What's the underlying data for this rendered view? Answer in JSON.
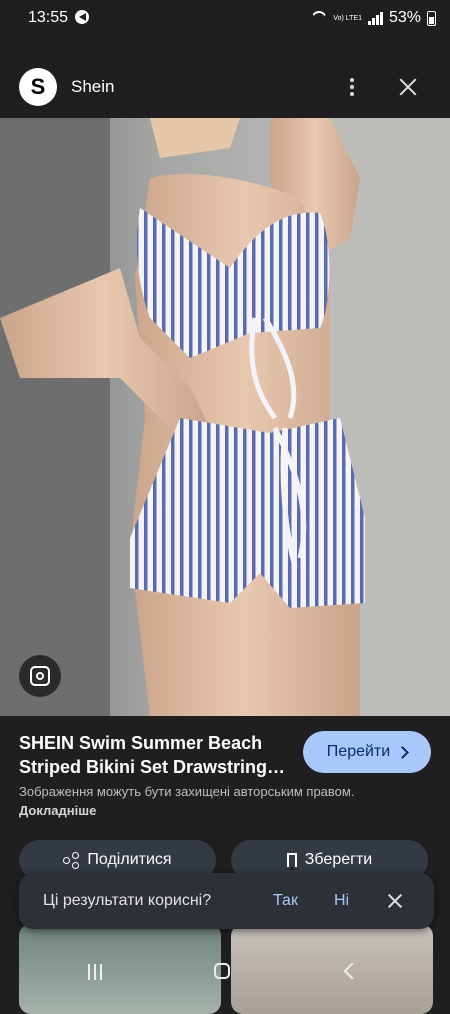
{
  "status_bar": {
    "time": "13:55",
    "lte_label": "Vo) LTE1",
    "battery": "53%"
  },
  "header": {
    "logo_letter": "S",
    "source_name": "Shein"
  },
  "result": {
    "title": "SHEIN Swim Summer Beach Striped Bikini Set Drawstring…",
    "visit_label": "Перейти",
    "copyright_note": "Зображення можуть бути захищені авторським правом.",
    "learn_more": "Докладніше"
  },
  "actions": {
    "share_label": "Поділитися",
    "save_label": "Зберегти"
  },
  "feedback": {
    "question": "Ці результати корисні?",
    "yes": "Так",
    "no": "Ні"
  },
  "colors": {
    "background": "#1f1f1f",
    "accent_button": "#a8c7fa",
    "secondary_button": "#333a44"
  },
  "icons": [
    "media-play-icon",
    "wifi-icon",
    "signal-icon",
    "battery-icon",
    "more-vert-icon",
    "close-icon",
    "lens-icon",
    "chevron-right-icon",
    "share-icon",
    "bookmark-icon",
    "recents-icon",
    "home-icon",
    "back-icon"
  ]
}
